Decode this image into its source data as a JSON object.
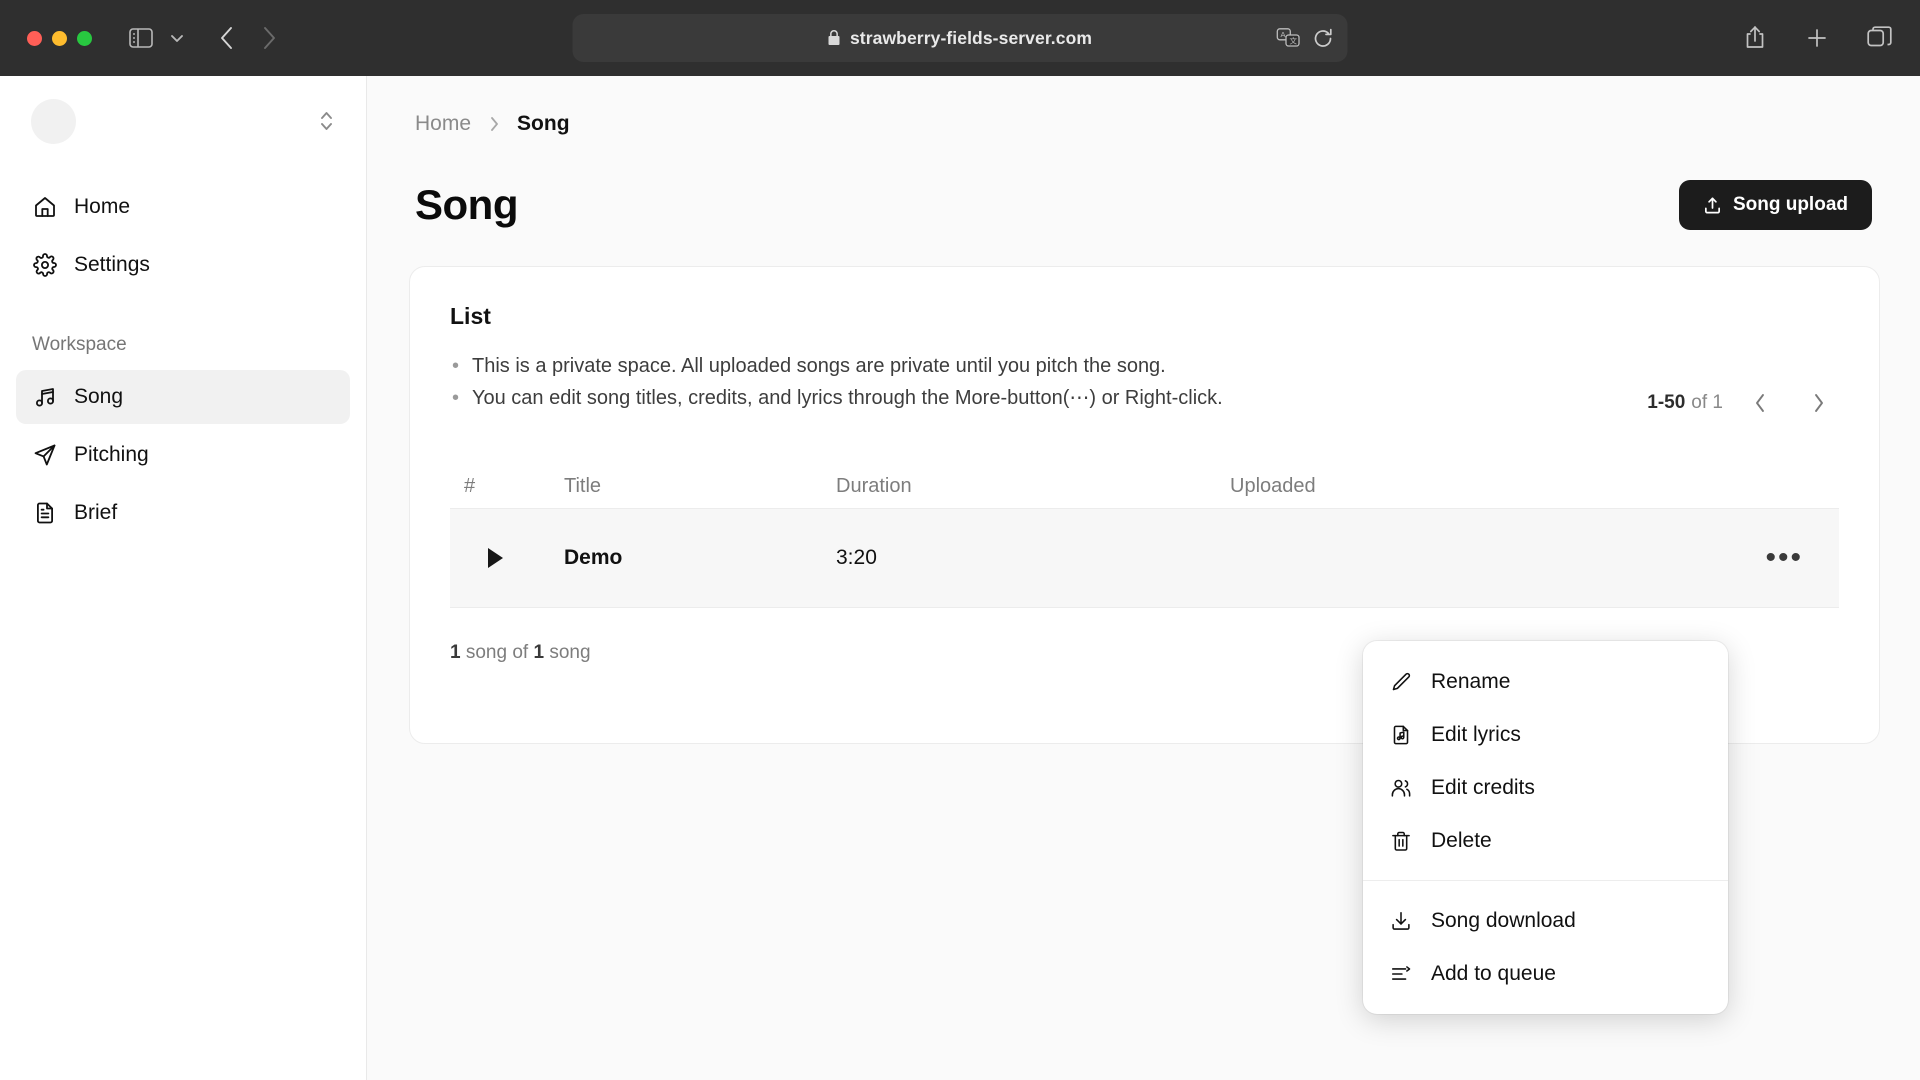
{
  "browser": {
    "url": "strawberry-fields-server.com",
    "lock_icon": "lock-icon",
    "sidebar_toggle_icon": "sidebar-toggle-icon",
    "tab_menu_icon": "chevron-down-icon",
    "back_icon": "chevron-left-icon",
    "forward_icon": "chevron-right-icon",
    "translate_icon": "translate-icon",
    "reload_icon": "reload-icon",
    "share_icon": "share-icon",
    "new_tab_icon": "plus-icon",
    "tabs_overview_icon": "tabs-overview-icon"
  },
  "sidebar": {
    "workspace_switcher": {
      "avatar": "avatar-placeholder",
      "chevron": "chevron-up-down-icon"
    },
    "items": [
      {
        "label": "Home",
        "icon": "home-icon",
        "active": false
      },
      {
        "label": "Settings",
        "icon": "gear-icon",
        "active": false
      }
    ],
    "section_label": "Workspace",
    "workspace_items": [
      {
        "label": "Song",
        "icon": "music-note-icon",
        "active": true
      },
      {
        "label": "Pitching",
        "icon": "paper-plane-icon",
        "active": false
      },
      {
        "label": "Brief",
        "icon": "document-icon",
        "active": false
      }
    ]
  },
  "breadcrumb": {
    "home": "Home",
    "separator": "chevron-right-icon",
    "current": "Song"
  },
  "page": {
    "title": "Song",
    "upload_button": {
      "label": "Song upload",
      "icon": "upload-icon"
    }
  },
  "card": {
    "title": "List",
    "bullets": [
      "This is a private space. All uploaded songs are private until you pitch the song.",
      "You can edit song titles, credits, and lyrics through the More-button(⋯) or Right-click."
    ],
    "pagination": {
      "range": "1-50",
      "of": "of 1",
      "prev_icon": "chevron-left-icon",
      "next_icon": "chevron-right-icon"
    },
    "table": {
      "headers": [
        "#",
        "Title",
        "Duration",
        "Uploaded"
      ],
      "rows": [
        {
          "play": "play-icon",
          "title": "Demo",
          "duration": "3:20",
          "uploaded": "",
          "more": "more-horizontal-icon"
        }
      ]
    },
    "footer": {
      "count": "1",
      "mid": " song of ",
      "total": "1",
      "suffix": " song"
    }
  },
  "context_menu": {
    "groups": [
      [
        {
          "label": "Rename",
          "icon": "pencil-icon"
        },
        {
          "label": "Edit lyrics",
          "icon": "music-file-icon"
        },
        {
          "label": "Edit credits",
          "icon": "users-icon"
        },
        {
          "label": "Delete",
          "icon": "trash-icon"
        }
      ],
      [
        {
          "label": "Song download",
          "icon": "download-icon"
        },
        {
          "label": "Add to queue",
          "icon": "queue-icon"
        }
      ]
    ]
  },
  "colors": {
    "accent_dark": "#1c1c1c",
    "chrome_bg": "#2f2f2f",
    "canvas": "#fafafa",
    "row_highlight": "#f7f7f7",
    "traffic_red": "#ff5f57",
    "traffic_yellow": "#febc2e",
    "traffic_green": "#28c840"
  }
}
